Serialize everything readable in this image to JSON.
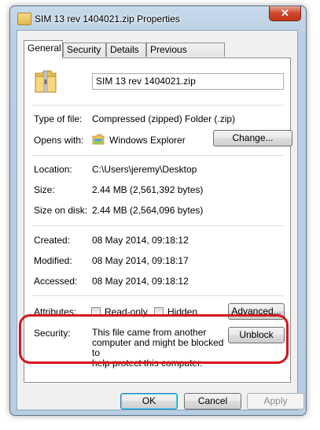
{
  "window": {
    "title": "SIM 13 rev 1404021.zip Properties",
    "close_symbol": "✕"
  },
  "tabs": [
    {
      "label": "General",
      "active": true
    },
    {
      "label": "Security",
      "active": false
    },
    {
      "label": "Details",
      "active": false
    },
    {
      "label": "Previous Versions",
      "active": false
    }
  ],
  "general": {
    "filename": "SIM 13 rev 1404021.zip",
    "type_label": "Type of file:",
    "type_value": "Compressed (zipped) Folder (.zip)",
    "opens_label": "Opens with:",
    "opens_value": "Windows Explorer",
    "change_button": "Change...",
    "location_label": "Location:",
    "location_value": "C:\\Users\\jeremy\\Desktop",
    "size_label": "Size:",
    "size_value": "2.44 MB (2,561,392 bytes)",
    "size_on_disk_label": "Size on disk:",
    "size_on_disk_value": "2.44 MB (2,564,096 bytes)",
    "created_label": "Created:",
    "created_value": "08 May 2014, 09:18:12",
    "modified_label": "Modified:",
    "modified_value": "08 May 2014, 09:18:17",
    "accessed_label": "Accessed:",
    "accessed_value": "08 May 2014, 09:18:12",
    "attributes_label": "Attributes:",
    "readonly_label": "Read-only",
    "readonly_checked": false,
    "hidden_label": "Hidden",
    "hidden_checked": false,
    "advanced_button": "Advanced...",
    "security_label": "Security:",
    "security_line1": "This file came from another",
    "security_line2": "computer and might be blocked to",
    "security_line3": "help protect this computer.",
    "unblock_button": "Unblock"
  },
  "footer": {
    "ok_button": "OK",
    "cancel_button": "Cancel",
    "apply_button": "Apply"
  },
  "colors": {
    "highlight_ring": "#d4161c",
    "window_frame": "#b9cfe4",
    "close_button": "#d0462b"
  },
  "icons": {
    "title": "zip-folder-icon",
    "file": "zip-folder-icon",
    "opens_with": "windows-explorer-icon",
    "close": "close-icon"
  }
}
